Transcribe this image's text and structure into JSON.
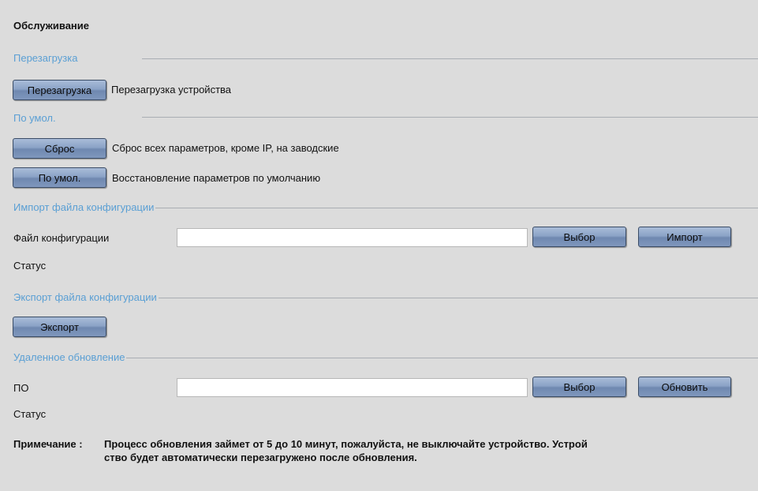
{
  "page": {
    "title": "Обслуживание"
  },
  "reboot": {
    "section_label": "Перезагрузка",
    "button_label": "Перезагрузка",
    "description": "Перезагрузка устройства"
  },
  "defaults": {
    "section_label": "По умол.",
    "reset_button_label": "Сброс",
    "reset_description": "Сброс всех параметров, кроме IP, на заводские",
    "restore_button_label": "По умол.",
    "restore_description": "Восстановление параметров по умолчанию"
  },
  "import_config": {
    "section_label": "Импорт файла конфигурации",
    "file_label": "Файл конфигурации",
    "file_value": "",
    "browse_button_label": "Выбор",
    "import_button_label": "Импорт",
    "status_label": "Статус"
  },
  "export_config": {
    "section_label": "Экспорт файла конфигурации",
    "export_button_label": "Экспорт"
  },
  "remote_upgrade": {
    "section_label": "Удаленное обновление",
    "file_label": "ПО",
    "file_value": "",
    "browse_button_label": "Выбор",
    "upgrade_button_label": "Обновить",
    "status_label": "Статус"
  },
  "note": {
    "label": "Примечание :",
    "line1": "Процесс обновления займет от 5 до 10 минут, пожалуйста, не выключайте устройство. Устрой",
    "line2": "ство будет автоматически перезагружено после обновления."
  },
  "colors": {
    "background": "#dcdcdc",
    "section_label": "#5a9fd4",
    "button_top": "#a9bcd8",
    "button_bottom": "#6f88b0"
  }
}
